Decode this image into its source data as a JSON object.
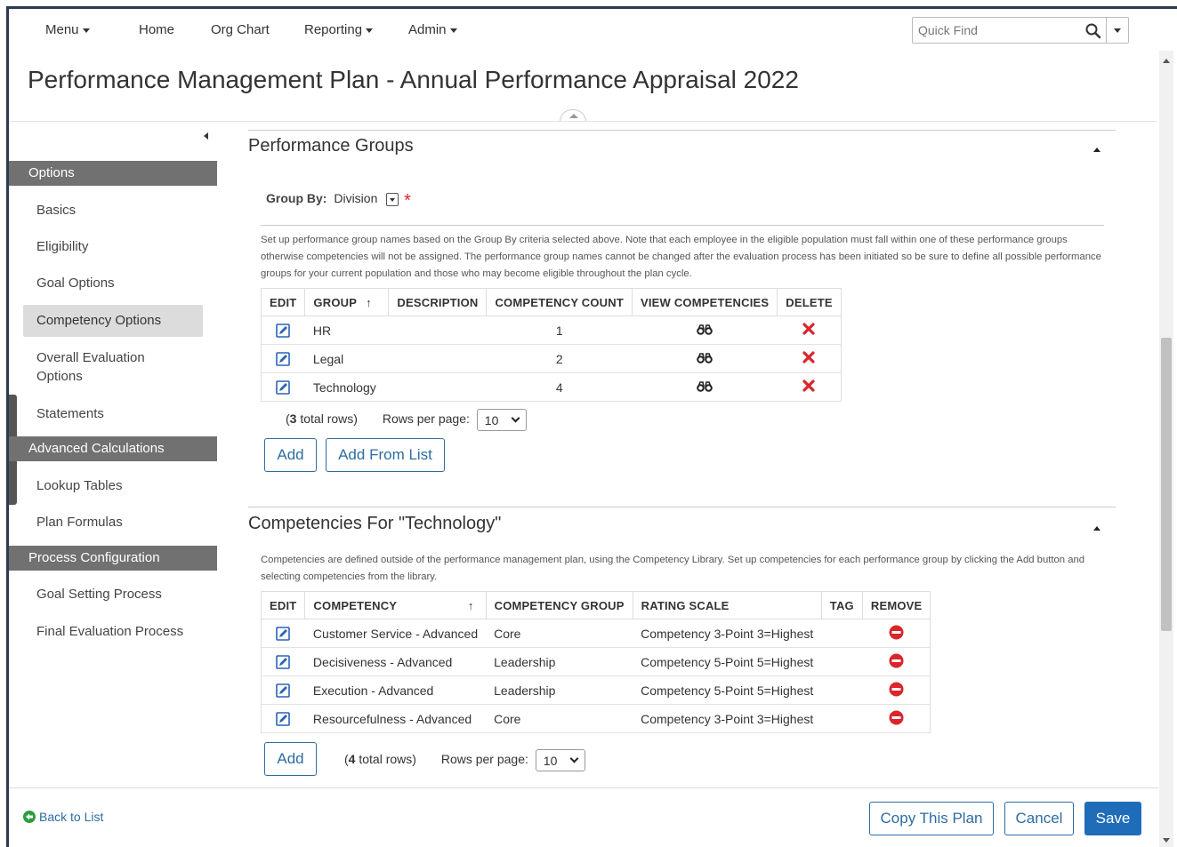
{
  "nav": {
    "menu": "Menu",
    "home": "Home",
    "org_chart": "Org Chart",
    "reporting": "Reporting",
    "admin": "Admin",
    "quick_find_placeholder": "Quick Find"
  },
  "page_title": "Performance Management Plan - Annual Performance Appraisal 2022",
  "sidebar": {
    "headers": [
      "Options",
      "Advanced Calculations",
      "Process Configuration"
    ],
    "items": [
      "Basics",
      "Eligibility",
      "Goal Options",
      "Competency Options",
      "Overall Evaluation Options",
      "Statements",
      "Lookup Tables",
      "Plan Formulas",
      "Goal Setting Process",
      "Final Evaluation Process"
    ],
    "active_item": "Competency Options"
  },
  "performance_groups": {
    "title": "Performance Groups",
    "group_by_label": "Group By:",
    "group_by_value": "Division",
    "required_mark": "*",
    "description": "Set up performance group names based on the Group By criteria selected above. Note that each employee in the eligible population must fall within one of these performance groups otherwise competencies will not be assigned. The performance group names cannot be changed after the evaluation process has been initiated so be sure to define all possible performance groups for your current population and those who may become eligible throughout the plan cycle.",
    "columns": [
      "EDIT",
      "GROUP",
      "DESCRIPTION",
      "COMPETENCY COUNT",
      "VIEW COMPETENCIES",
      "DELETE"
    ],
    "sort_arrow": "↑",
    "rows": [
      {
        "group": "HR",
        "description": "",
        "count": "1"
      },
      {
        "group": "Legal",
        "description": "",
        "count": "2"
      },
      {
        "group": "Technology",
        "description": "",
        "count": "4"
      }
    ],
    "total_rows_count": "3",
    "total_rows_suffix": " total rows)",
    "rows_per_page_label": "Rows per page:",
    "rows_per_page": "10",
    "add_button": "Add",
    "add_from_list_button": "Add From List"
  },
  "competencies": {
    "title": "Competencies For \"Technology\"",
    "description": "Competencies are defined outside of the performance management plan, using the Competency Library. Set up competencies for each performance group by clicking the Add button and selecting competencies from the library.",
    "columns": [
      "EDIT",
      "COMPETENCY",
      "COMPETENCY GROUP",
      "RATING SCALE",
      "TAG",
      "REMOVE"
    ],
    "sort_arrow": "↑",
    "rows": [
      {
        "competency": "Customer Service - Advanced",
        "group": "Core",
        "scale": "Competency 3-Point 3=Highest",
        "tag": ""
      },
      {
        "competency": "Decisiveness - Advanced",
        "group": "Leadership",
        "scale": "Competency 5-Point 5=Highest",
        "tag": ""
      },
      {
        "competency": "Execution - Advanced",
        "group": "Leadership",
        "scale": "Competency 5-Point 5=Highest",
        "tag": ""
      },
      {
        "competency": "Resourcefulness - Advanced",
        "group": "Core",
        "scale": "Competency 3-Point 3=Highest",
        "tag": ""
      }
    ],
    "total_rows_count": "4",
    "total_rows_suffix": " total rows)",
    "rows_per_page_label": "Rows per page:",
    "rows_per_page": "10",
    "add_button": "Add"
  },
  "footer": {
    "back_link": "Back to List",
    "copy_button": "Copy This Plan",
    "cancel_button": "Cancel",
    "save_button": "Save"
  },
  "colors": {
    "accent": "#1f6cb8",
    "link": "#2d6ca2",
    "sidebar_header": "#717171",
    "delete_red": "#d9262b",
    "back_green": "#2e9e3f"
  }
}
